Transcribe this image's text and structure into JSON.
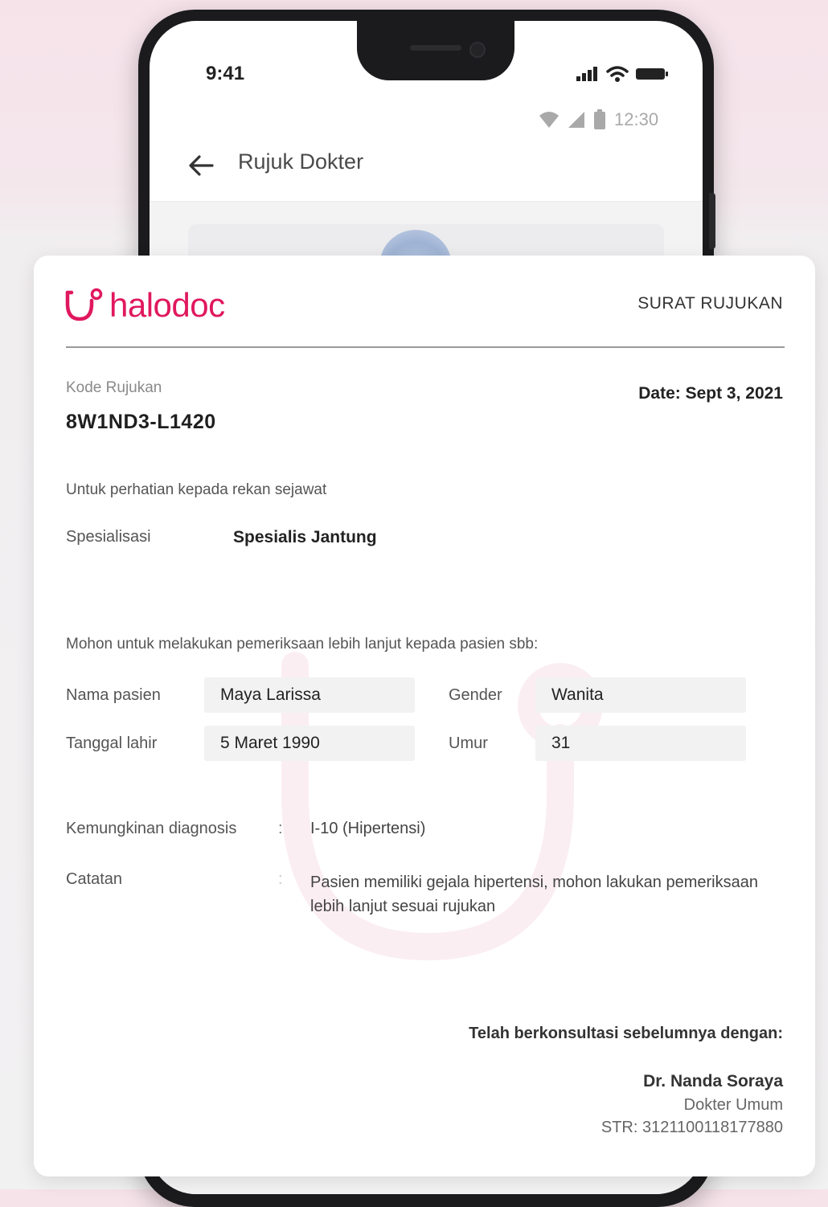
{
  "status_bar": {
    "time": "9:41"
  },
  "android_status": {
    "time": "12:30"
  },
  "app_header": {
    "title": "Rujuk Dokter"
  },
  "letter": {
    "brand": "halodoc",
    "doc_title": "SURAT RUJUKAN",
    "kode_label": "Kode Rujukan",
    "kode_value": "8W1ND3-L1420",
    "date": "Date: Sept 3, 2021",
    "attention": "Untuk perhatian kepada rekan sejawat",
    "specialization_label": "Spesialisasi",
    "specialization_value": "Spesialis Jantung",
    "request": "Mohon untuk melakukan pemeriksaan lebih lanjut kepada pasien sbb:",
    "patient": {
      "name_label": "Nama pasien",
      "name_value": "Maya Larissa",
      "gender_label": "Gender",
      "gender_value": "Wanita",
      "dob_label": "Tanggal lahir",
      "dob_value": "5 Maret 1990",
      "age_label": "Umur",
      "age_value": "31"
    },
    "diagnosis_label": "Kemungkinan diagnosis",
    "diagnosis_value": "I-10 (Hipertensi)",
    "note_label": "Catatan",
    "note_value": "Pasien memiliki gejala hipertensi, mohon lakukan pemeriksaan lebih lanjut sesuai rujukan",
    "colon": ":",
    "consult_text": "Telah berkonsultasi sebelumnya dengan:",
    "doctor_name": "Dr. Nanda Soraya",
    "doctor_role": "Dokter Umum",
    "doctor_str": "STR: 3121100118177880"
  },
  "colors": {
    "brand": "#e0185e",
    "text": "#2b2b2b",
    "field_bg": "#f2f2f3"
  },
  "icons": [
    "signal-icon",
    "wifi-icon",
    "battery-icon",
    "android-wifi-icon",
    "android-signal-icon",
    "android-battery-icon",
    "back-arrow-icon",
    "halodoc-stethoscope-logo"
  ]
}
